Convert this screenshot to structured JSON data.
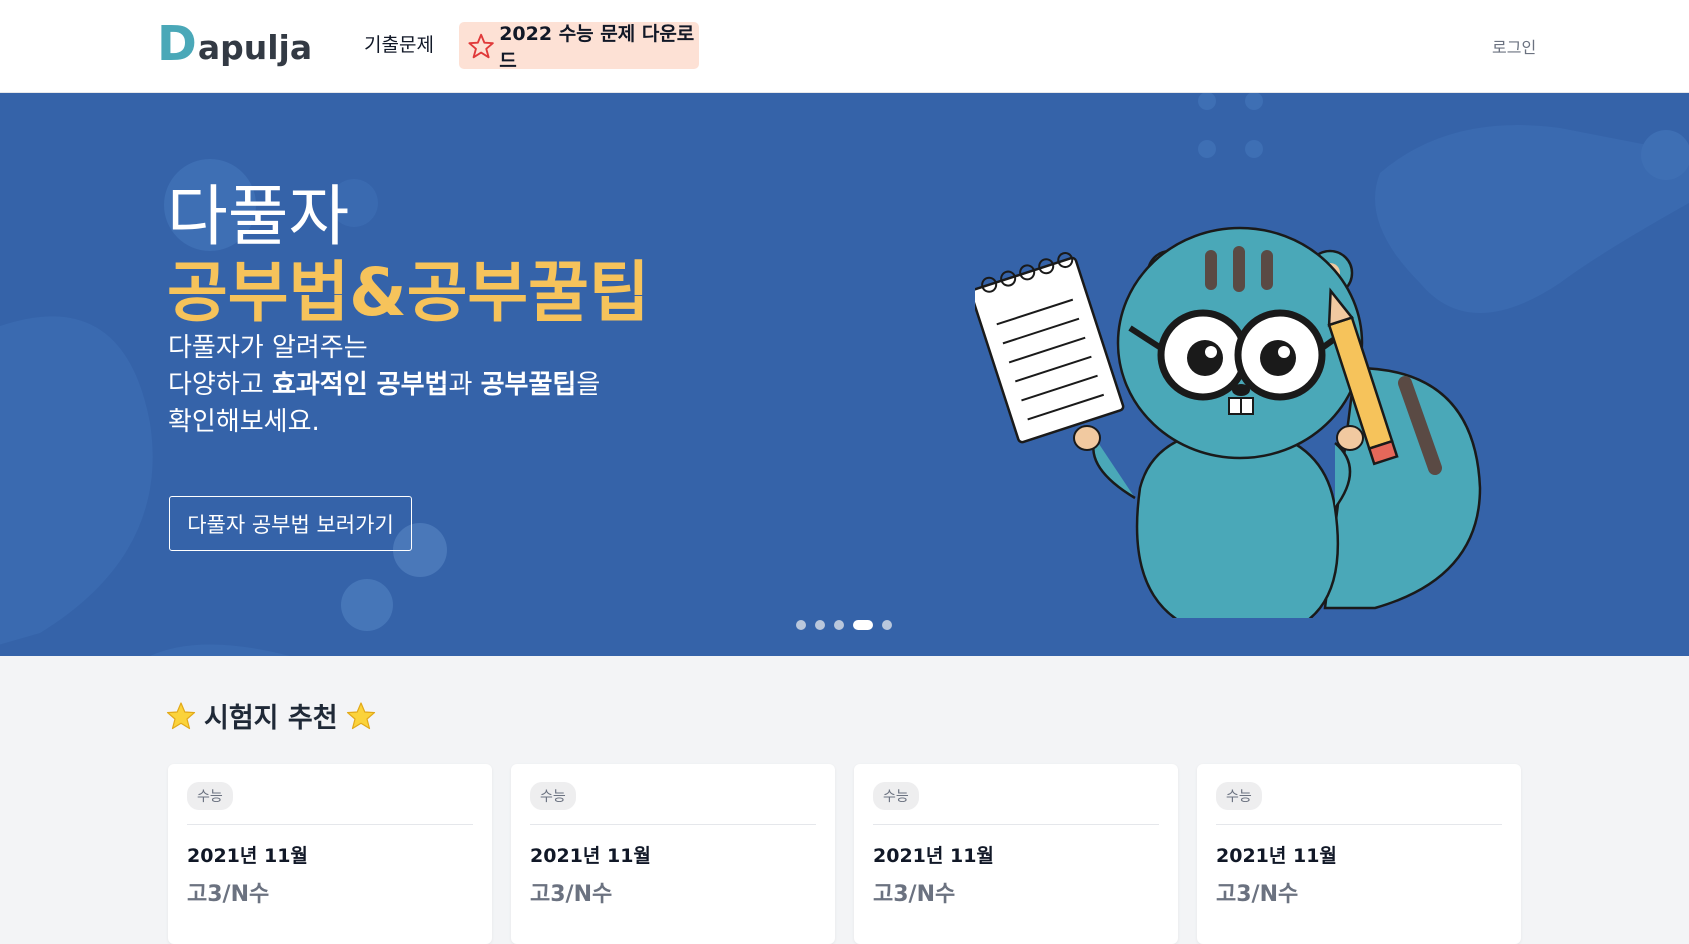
{
  "header": {
    "logo_first": "D",
    "logo_rest": "apulja",
    "nav_past_exams": "기출문제",
    "nav_download": "2022 수능 문제 다운로드",
    "login": "로그인"
  },
  "hero": {
    "title_line1": "다풀자",
    "title_line2": "공부법&공부꿀팁",
    "desc_line1": "다풀자가 알려주는",
    "desc_line2_a": "다양하고 ",
    "desc_line2_b": "효과적인 공부법",
    "desc_line2_c": "과 ",
    "desc_line2_d": "공부꿀팁",
    "desc_line2_e": "을",
    "desc_line3": "확인해보세요.",
    "button": "다풀자 공부법 보러가기",
    "slide_count": 5,
    "active_slide": 4
  },
  "recommend": {
    "title": "시험지 추천",
    "cards": [
      {
        "badge": "수능",
        "date": "2021년 11월",
        "grade": "고3/N수"
      },
      {
        "badge": "수능",
        "date": "2021년 11월",
        "grade": "고3/N수"
      },
      {
        "badge": "수능",
        "date": "2021년 11월",
        "grade": "고3/N수"
      },
      {
        "badge": "수능",
        "date": "2021년 11월",
        "grade": "고3/N수"
      }
    ]
  },
  "colors": {
    "hero_bg": "#3563a9",
    "accent_yellow": "#f6c35b",
    "logo_teal": "#4aa8b8",
    "download_bg": "#fde1d5",
    "mascot": "#4aa8b8"
  }
}
